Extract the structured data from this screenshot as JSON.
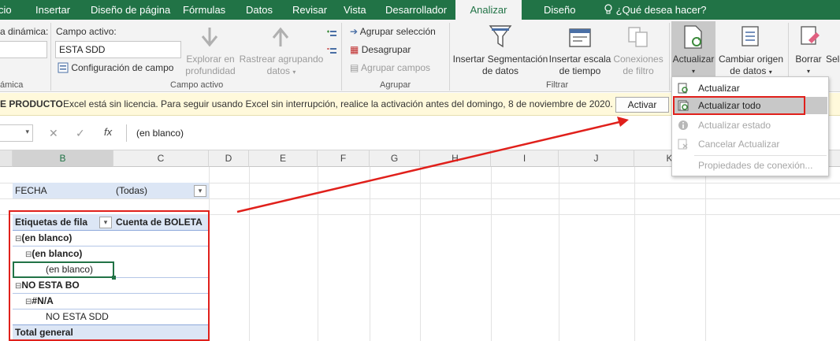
{
  "tabs": [
    "cio",
    "Insertar",
    "Diseño de página",
    "Fórmulas",
    "Datos",
    "Revisar",
    "Vista",
    "Desarrollador",
    "Analizar",
    "Diseño"
  ],
  "tell_me": "¿Qué desea hacer?",
  "ribbon": {
    "tabla_dinamica_label": "a dinámica:",
    "tabla_dinamica_group": "ámica",
    "campo_activo_label": "Campo activo:",
    "campo_activo_value": "ESTA SDD",
    "config_campo": "Configuración de campo",
    "explorar_1": "Explorar en",
    "explorar_2": "profundidad",
    "rastrear_1": "Rastrear agrupando",
    "rastrear_2": "datos",
    "campo_activo_group": "Campo activo",
    "agrupar_seleccion": "Agrupar selección",
    "desagrupar": "Desagrupar",
    "agrupar_campos": "Agrupar campos",
    "agrupar_group": "Agrupar",
    "insertar_seg_1": "Insertar Segmentación",
    "insertar_seg_2": "de datos",
    "insertar_esc_1": "Insertar escala",
    "insertar_esc_2": "de tiempo",
    "conexiones_1": "Conexiones",
    "conexiones_2": "de filtro",
    "filtrar_group": "Filtrar",
    "actualizar": "Actualizar",
    "cambiar_1": "Cambiar origen",
    "cambiar_2": "de datos",
    "borrar": "Borrar",
    "sel": "Sele"
  },
  "message": {
    "title": "E PRODUCTO",
    "text": "Excel está sin licencia. Para seguir usando Excel sin interrupción, realice la activación antes del domingo, 8 de noviembre de 2020.",
    "button": "Activar"
  },
  "formula": {
    "value": "(en blanco)",
    "fx": "fx"
  },
  "columns": [
    "B",
    "C",
    "D",
    "E",
    "F",
    "G",
    "H",
    "I",
    "J",
    "K"
  ],
  "pivot": {
    "filter_label": "FECHA",
    "filter_value": "(Todas)",
    "header_rows": "Etiquetas de fila",
    "header_values": "Cuenta de BOLETA",
    "rows": [
      {
        "label": "(en blanco)"
      },
      {
        "label": "(en blanco)"
      },
      {
        "label": "(en blanco)"
      },
      {
        "label": "NO ESTA BO"
      },
      {
        "label": "#N/A"
      },
      {
        "label": "NO ESTA SDD"
      }
    ],
    "total": "Total general"
  },
  "menu": {
    "items": [
      "Actualizar",
      "Actualizar todo",
      "Actualizar estado",
      "Cancelar Actualizar",
      "Propiedades de conexión..."
    ]
  },
  "colors": {
    "accent": "#217346",
    "annotation": "#e0201b"
  }
}
